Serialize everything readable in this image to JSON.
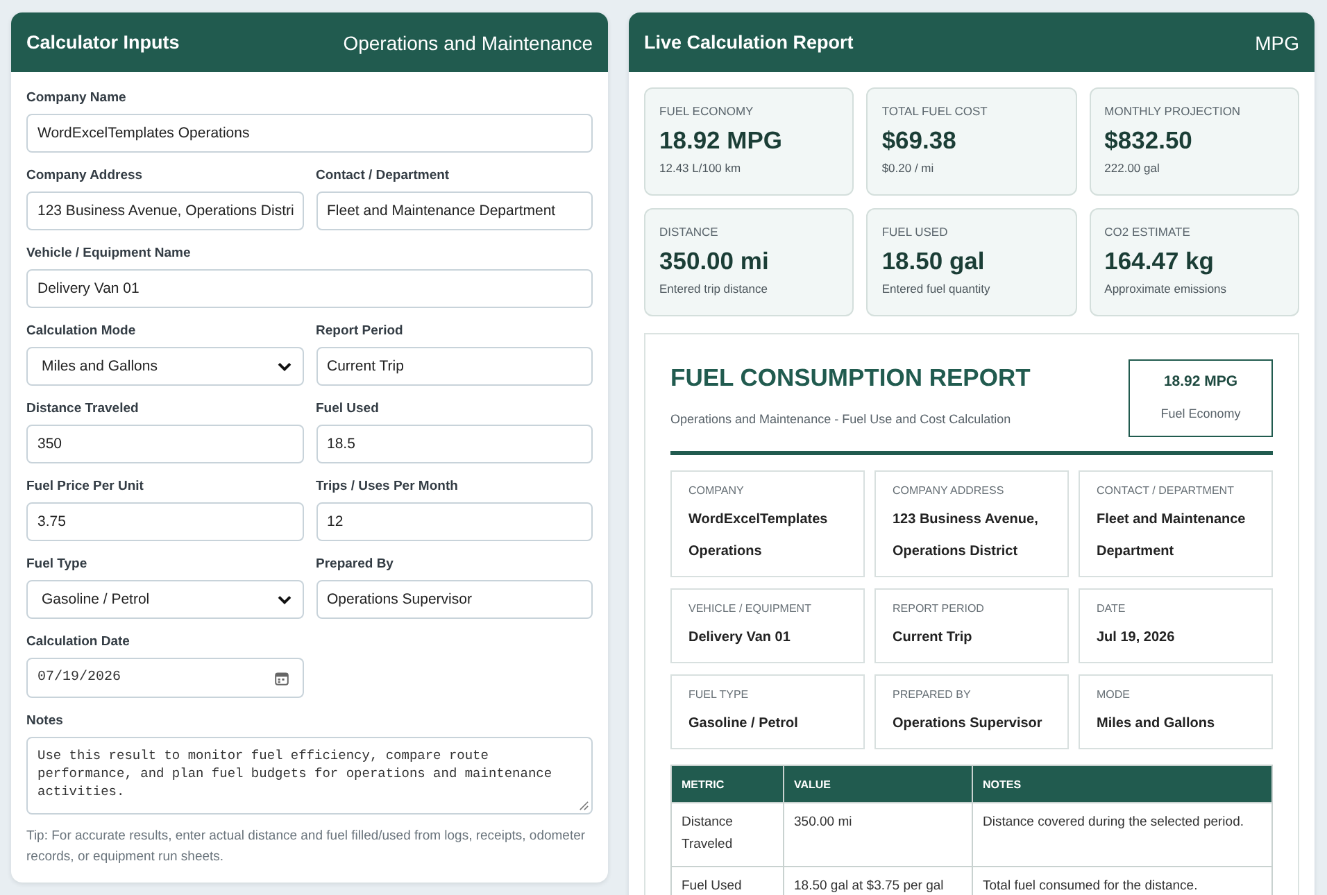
{
  "input_panel": {
    "title": "Calculator Inputs",
    "subtitle": "Operations and Maintenance",
    "rows": [
      [
        {
          "kind": "text",
          "label": "Company Name",
          "value": "WordExcelTemplates Operations"
        }
      ],
      [
        {
          "kind": "text",
          "label": "Company Address",
          "value": "123 Business Avenue, Operations Distri"
        },
        {
          "kind": "text",
          "label": "Contact / Department",
          "value": "Fleet and Maintenance Department"
        }
      ],
      [
        {
          "kind": "text",
          "label": "Vehicle / Equipment Name",
          "value": "Delivery Van 01"
        }
      ],
      [
        {
          "kind": "select",
          "label": "Calculation Mode",
          "value": "Miles and Gallons"
        },
        {
          "kind": "text",
          "label": "Report Period",
          "value": "Current Trip"
        }
      ],
      [
        {
          "kind": "text",
          "label": "Distance Traveled",
          "value": "350"
        },
        {
          "kind": "text",
          "label": "Fuel Used",
          "value": "18.5"
        }
      ],
      [
        {
          "kind": "text",
          "label": "Fuel Price Per Unit",
          "value": "3.75"
        },
        {
          "kind": "text",
          "label": "Trips / Uses Per Month",
          "value": "12"
        }
      ],
      [
        {
          "kind": "select",
          "label": "Fuel Type",
          "value": "Gasoline / Petrol"
        },
        {
          "kind": "text",
          "label": "Prepared By",
          "value": "Operations Supervisor"
        }
      ],
      [
        {
          "kind": "date",
          "label": "Calculation Date",
          "value": "07/19/2026"
        }
      ],
      [
        {
          "kind": "textarea",
          "label": "Notes",
          "value": "Use this result to monitor fuel efficiency, compare route performance, and plan fuel budgets for operations and maintenance activities."
        }
      ]
    ],
    "tip": "Tip: For accurate results, enter actual distance and fuel filled/used from logs, receipts, odometer records, or equipment run sheets."
  },
  "report_panel": {
    "title": "Live Calculation Report",
    "unit": "MPG",
    "cards": [
      {
        "label": "FUEL ECONOMY",
        "value": "18.92 MPG",
        "detail": "12.43 L/100 km"
      },
      {
        "label": "TOTAL FUEL COST",
        "value": "$69.38",
        "detail": "$0.20 / mi"
      },
      {
        "label": "MONTHLY PROJECTION",
        "value": "$832.50",
        "detail": "222.00 gal"
      },
      {
        "label": "DISTANCE",
        "value": "350.00 mi",
        "detail": "Entered trip distance"
      },
      {
        "label": "FUEL USED",
        "value": "18.50 gal",
        "detail": "Entered fuel quantity"
      },
      {
        "label": "CO2 ESTIMATE",
        "value": "164.47 kg",
        "detail": "Approximate emissions"
      }
    ],
    "report": {
      "title": "FUEL CONSUMPTION REPORT",
      "subtitle": "Operations and Maintenance - Fuel Use and Cost Calculation",
      "badge": {
        "value": "18.92 MPG",
        "label": "Fuel Economy"
      },
      "details": [
        {
          "label": "COMPANY",
          "value": "WordExcelTemplates Operations"
        },
        {
          "label": "COMPANY ADDRESS",
          "value": "123 Business Avenue, Operations District"
        },
        {
          "label": "CONTACT / DEPARTMENT",
          "value": "Fleet and Maintenance Department"
        },
        {
          "label": "VEHICLE / EQUIPMENT",
          "value": "Delivery Van 01"
        },
        {
          "label": "REPORT PERIOD",
          "value": "Current Trip"
        },
        {
          "label": "DATE",
          "value": "Jul 19, 2026"
        },
        {
          "label": "FUEL TYPE",
          "value": "Gasoline / Petrol"
        },
        {
          "label": "PREPARED BY",
          "value": "Operations Supervisor"
        },
        {
          "label": "MODE",
          "value": "Miles and Gallons"
        }
      ],
      "table": {
        "columns": [
          "METRIC",
          "VALUE",
          "NOTES"
        ],
        "rows": [
          [
            "Distance Traveled",
            "350.00 mi",
            "Distance covered during the selected period."
          ],
          [
            "Fuel Used",
            "18.50 gal at $3.75 per gal",
            "Total fuel consumed for the distance."
          ]
        ]
      }
    }
  }
}
